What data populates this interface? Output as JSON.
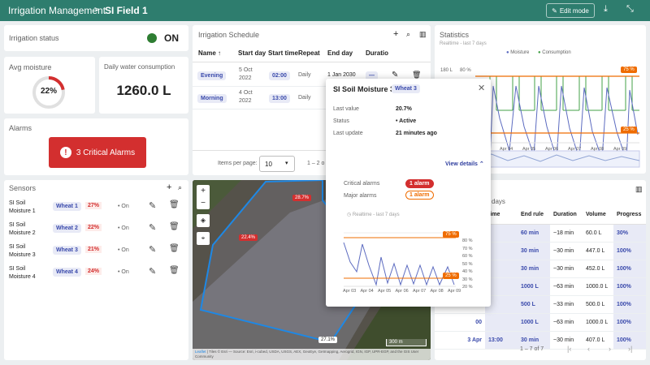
{
  "header": {
    "app_title": "Irrigation Management",
    "separator": ">",
    "field_title": "SI Field 1",
    "edit_label": "Edit mode"
  },
  "status": {
    "label": "Irrigation status",
    "value": "ON",
    "color": "#2e7d32"
  },
  "moisture": {
    "label": "Avg moisture",
    "value": "22%",
    "fraction": 0.22
  },
  "water": {
    "label": "Daily water consumption",
    "value": "1260.0 L"
  },
  "alarms": {
    "label": "Alarms",
    "button": "3 Critical Alarms",
    "color": "#d32f2f"
  },
  "sensors": {
    "title": "Sensors",
    "items": [
      {
        "name1": "SI Soil",
        "name2": "Moisture 1",
        "tag": "Wheat 1",
        "pct": "27%",
        "state": "On"
      },
      {
        "name1": "SI Soil",
        "name2": "Moisture 2",
        "tag": "Wheat 2",
        "pct": "22%",
        "state": "On"
      },
      {
        "name1": "SI Soil",
        "name2": "Moisture 3",
        "tag": "Wheat 3",
        "pct": "21%",
        "state": "On"
      },
      {
        "name1": "SI Soil",
        "name2": "Moisture 4",
        "tag": "Wheat 4",
        "pct": "24%",
        "state": "On"
      }
    ]
  },
  "schedule": {
    "title": "Irrigation Schedule",
    "cols": [
      "Name",
      "Start day",
      "Start time",
      "Repeat",
      "End day",
      "Duratio"
    ],
    "rows": [
      {
        "name": "Evening",
        "day1": "5 Oct",
        "day2": "2022",
        "time": "02:00",
        "repeat": "Daily",
        "end": "1 Jan 2030",
        "dur": "—"
      },
      {
        "name": "Morning",
        "day1": "4 Oct",
        "day2": "2022",
        "time": "13:00",
        "repeat": "Daily",
        "end": "1 Ja",
        "dur": ""
      }
    ],
    "per_page_label": "Items per page:",
    "per_page": "10",
    "range": "1 – 2 o"
  },
  "statistics": {
    "title": "Statistics",
    "subtitle": "Realtime - last 7 days",
    "legend": [
      "Moisture",
      "Consumption"
    ],
    "ylabel_top": "180 L",
    "ylabel_pct": "80 %",
    "ticks": [
      "Apr 04",
      "Apr 05",
      "Apr 06",
      "Apr 07",
      "Apr 08",
      "Apr 09"
    ],
    "marker_high": "75 %",
    "marker_low": "25 %",
    "moisture_color": "#5c6bc0",
    "consumption_color": "#43a047",
    "threshold_color": "#ef6c00"
  },
  "map": {
    "labels": [
      "28.7%",
      "22.4%",
      "27.1%"
    ],
    "scale": "300 m",
    "leaflet": "Leaflet",
    "credit_rest": "| Tiles © Esri — Source: Esri, i-cubed, USDA, USGS, AEX, GeoEye, Getmapping, Aerogrid, IGN, IGP, UPR-EGP, and the GIS User Community"
  },
  "history": {
    "title": "days",
    "cols": [
      "time",
      "End rule",
      "Duration",
      "Volume",
      "Progress"
    ],
    "rows": [
      {
        "start": "00",
        "time": "",
        "end": "60 min",
        "dur": "~18 min",
        "vol": "60.0 L",
        "prog": "30%"
      },
      {
        "start": "00",
        "time": "",
        "end": "30 min",
        "dur": "~30 min",
        "vol": "447.0 L",
        "prog": "100%"
      },
      {
        "start": "00",
        "time": "",
        "end": "30 min",
        "dur": "~30 min",
        "vol": "452.0 L",
        "prog": "100%"
      },
      {
        "start": "00",
        "time": "",
        "end": "1000 L",
        "dur": "~63 min",
        "vol": "1000.0 L",
        "prog": "100%"
      },
      {
        "start": "00",
        "time": "",
        "end": "500 L",
        "dur": "~33 min",
        "vol": "500.0 L",
        "prog": "100%"
      },
      {
        "start": "00",
        "time": "",
        "end": "1000 L",
        "dur": "~63 min",
        "vol": "1000.0 L",
        "prog": "100%"
      },
      {
        "start": "3 Apr",
        "time": "13:00",
        "end": "30 min",
        "dur": "~30 min",
        "vol": "407.0 L",
        "prog": "100%"
      }
    ],
    "range": "1 – 7 of 7"
  },
  "popup": {
    "title": "SI Soil Moisture 3",
    "tag": "Wheat 3",
    "last_value_label": "Last value",
    "last_value": "20.7%",
    "status_label": "Status",
    "status": "Active",
    "update_label": "Last update",
    "update": "21 minutes ago",
    "view_details": "View details",
    "crit_label": "Critical alarms",
    "crit": "1 alarm",
    "major_label": "Major alarms",
    "major": "1 alarm",
    "realtime": "Realtime - last 7 days",
    "yticks": [
      "80 %",
      "70 %",
      "60 %",
      "50 %",
      "40 %",
      "30 %",
      "20 %"
    ],
    "xticks": [
      "Apr 03",
      "Apr 04",
      "Apr 05",
      "Apr 06",
      "Apr 07",
      "Apr 08",
      "Apr 09"
    ],
    "marker_high": "75 %",
    "marker_low": "25 %"
  }
}
